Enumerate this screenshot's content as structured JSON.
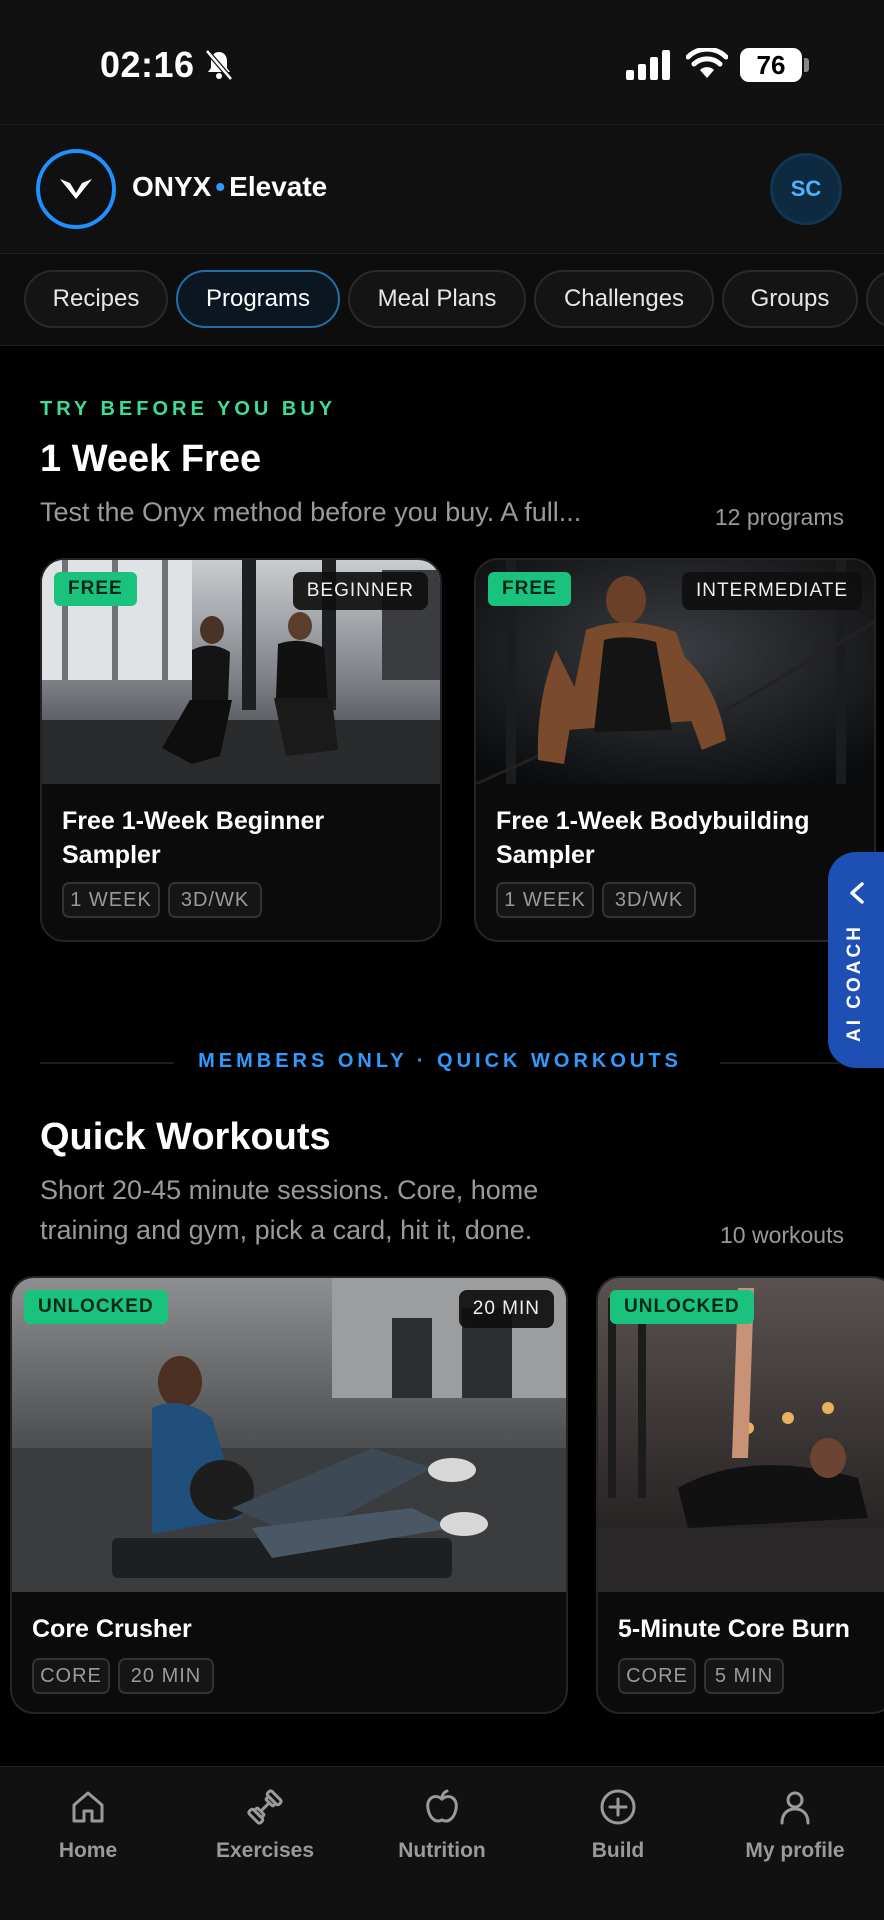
{
  "status_bar": {
    "time": "02:16",
    "battery": "76"
  },
  "header": {
    "brand": "ONYX",
    "brand_dot": "•",
    "brand_sub": "Elevate",
    "avatar_initials": "SC"
  },
  "categories": [
    {
      "label": "Recipes",
      "active": false
    },
    {
      "label": "Programs",
      "active": true
    },
    {
      "label": "Meal Plans",
      "active": false
    },
    {
      "label": "Challenges",
      "active": false
    },
    {
      "label": "Groups",
      "active": false
    }
  ],
  "trial_section": {
    "eyebrow": "TRY BEFORE YOU BUY",
    "title": "1 Week Free",
    "subtitle": "Test the Onyx method before you buy. A full...",
    "count": "12 programs",
    "cards": [
      {
        "badge": "FREE",
        "level": "BEGINNER",
        "title": "Free 1-Week Beginner Sampler",
        "tags": [
          "1 WEEK",
          "3D/WK"
        ]
      },
      {
        "badge": "FREE",
        "level": "INTERMEDIATE",
        "title": "Free 1-Week Bodybuilding Sampler",
        "tags": [
          "1 WEEK",
          "3D/WK"
        ]
      }
    ]
  },
  "divider_label": "MEMBERS ONLY · QUICK WORKOUTS",
  "quick_section": {
    "title": "Quick Workouts",
    "subtitle_lines": [
      "Short 20-45 minute sessions. Core, home",
      "training and gym, pick a card, hit it, done."
    ],
    "count": "10 workouts",
    "cards": [
      {
        "badge": "UNLOCKED",
        "duration_badge": "20 MIN",
        "title": "Core Crusher",
        "tags": [
          "CORE",
          "20 MIN"
        ]
      },
      {
        "badge": "UNLOCKED",
        "title": "5-Minute Core Burn",
        "tags": [
          "CORE",
          "5 MIN"
        ]
      }
    ]
  },
  "ai_coach": {
    "label": "AI COACH"
  },
  "bottom_nav": [
    {
      "label": "Home",
      "icon": "home-icon"
    },
    {
      "label": "Exercises",
      "icon": "dumbbell-icon"
    },
    {
      "label": "Nutrition",
      "icon": "apple-icon"
    },
    {
      "label": "Build",
      "icon": "plus-circle-icon"
    },
    {
      "label": "My profile",
      "icon": "person-icon"
    }
  ],
  "colors": {
    "accent_blue": "#1e90ff",
    "accent_green": "#19c37d",
    "background": "#000000",
    "ai_coach_blue": "#1e4fb5"
  }
}
